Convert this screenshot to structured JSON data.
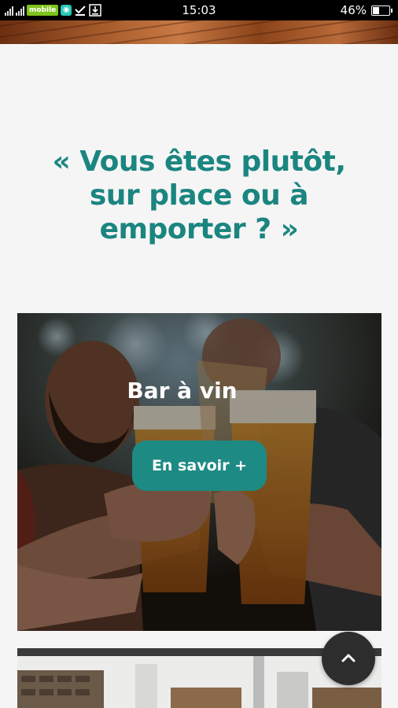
{
  "status_bar": {
    "carrier": "mobile",
    "time": "15:03",
    "battery_percent": "46%",
    "battery_level": 0.46,
    "icons": [
      "signal-icon",
      "signal-icon",
      "carrier-badge",
      "chat-app-icon",
      "check-download-icon",
      "download-icon",
      "battery-icon"
    ]
  },
  "hero": {
    "headline": "« Vous êtes plutôt, sur place ou à emporter ? »"
  },
  "cards": [
    {
      "title": "Bar à vin",
      "button_label": "En savoir +"
    }
  ],
  "scroll_top": {
    "icon": "chevron-up-icon"
  },
  "colors": {
    "accent": "#1b8580",
    "button": "#1e8a84",
    "fab": "#2d2d2d",
    "background": "#f5f5f5"
  }
}
